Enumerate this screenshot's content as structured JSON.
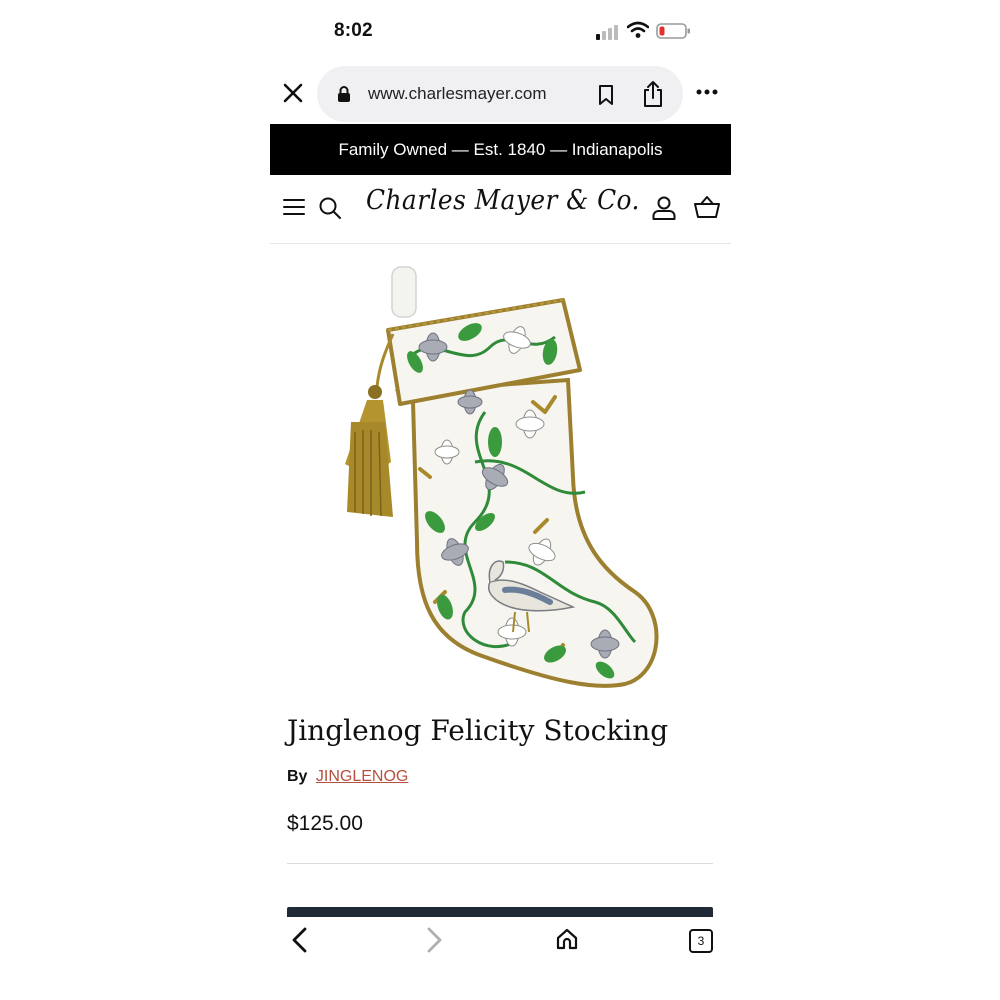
{
  "status_bar": {
    "time": "8:02"
  },
  "browser": {
    "url": "www.charlesmayer.com",
    "tab_count": "3"
  },
  "announcement": {
    "text": "Family Owned — Est. 1840 — Indianapolis"
  },
  "header": {
    "logo_text": "Charles Mayer & Co."
  },
  "product": {
    "title": "Jinglenog Felicity Stocking",
    "by_label": "By",
    "vendor": "JINGLENOG",
    "price": "$125.00"
  },
  "colors": {
    "announcement_bg": "#000000",
    "vendor_link": "#b5503e",
    "cta_button": "#1f2a36",
    "battery_low": "#e0322f"
  },
  "icons": [
    "close-icon",
    "lock-icon",
    "bookmark-icon",
    "share-icon",
    "more-icon",
    "menu-icon",
    "search-icon",
    "account-icon",
    "cart-icon",
    "back-icon",
    "forward-icon",
    "home-icon",
    "tabs-icon"
  ]
}
